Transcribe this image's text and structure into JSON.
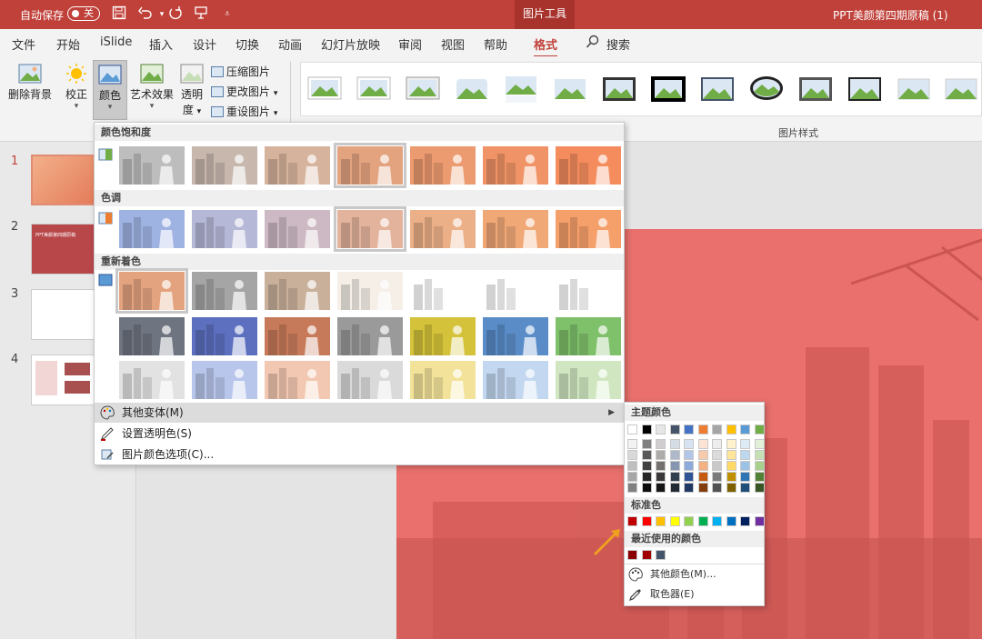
{
  "titlebar": {
    "autosave_label": "自动保存",
    "toggle_label": "关",
    "context_tab": "图片工具",
    "doc_title": "PPT美颜第四期原稿 (1)",
    "quick_icons": [
      "save-icon",
      "undo-icon",
      "redo-icon",
      "present-icon",
      "customize-icon"
    ]
  },
  "tabs": {
    "items": [
      {
        "label": "文件"
      },
      {
        "label": "开始"
      },
      {
        "label": "iSlide"
      },
      {
        "label": "插入"
      },
      {
        "label": "设计"
      },
      {
        "label": "切换"
      },
      {
        "label": "动画"
      },
      {
        "label": "幻灯片放映"
      },
      {
        "label": "审阅"
      },
      {
        "label": "视图"
      },
      {
        "label": "帮助"
      },
      {
        "label": "格式"
      }
    ],
    "active": "格式",
    "search_label": "搜索"
  },
  "ribbon": {
    "remove_bg": "删除背景",
    "correct": "校正",
    "color": "颜色",
    "artistic": "艺术效果",
    "transparency_1": "透明",
    "transparency_2": "度",
    "compress": "压缩图片",
    "change": "更改图片",
    "reset": "重设图片",
    "styles_group": "图片样式"
  },
  "slides": {
    "numbers": [
      "1",
      "2",
      "3",
      "4"
    ],
    "thumb2_text": "PPT美颜第四期原稿"
  },
  "color_menu": {
    "saturation_header": "颜色饱和度",
    "tone_header": "色调",
    "recolor_header": "重新着色",
    "more_variants": "其他变体(M)",
    "set_transparent": "设置透明色(S)",
    "color_options": "图片颜色选项(C)..."
  },
  "color_palette": {
    "theme_header": "主题颜色",
    "standard_header": "标准色",
    "recent_header": "最近使用的颜色",
    "more_colors": "其他颜色(M)...",
    "eyedropper": "取色器(E)",
    "theme_top": [
      "#ffffff",
      "#000000",
      "#e7e6e6",
      "#44546a",
      "#4472c4",
      "#ed7d31",
      "#a5a5a5",
      "#ffc000",
      "#5b9bd5",
      "#70ad47"
    ],
    "theme_shades": [
      [
        "#f2f2f2",
        "#808080",
        "#d0cece",
        "#d6dce4",
        "#d9e2f3",
        "#fbe4d5",
        "#ededed",
        "#fff2cc",
        "#deebf6",
        "#e2efd9"
      ],
      [
        "#d9d9d9",
        "#595959",
        "#aeabab",
        "#adb9ca",
        "#b4c6e7",
        "#f7caac",
        "#dbdbdb",
        "#fee599",
        "#bdd7ee",
        "#c5e0b3"
      ],
      [
        "#bfbfbf",
        "#404040",
        "#757070",
        "#8496b0",
        "#8eaadb",
        "#f4b183",
        "#c9c9c9",
        "#ffd966",
        "#9cc3e5",
        "#a8d08d"
      ],
      [
        "#a6a6a6",
        "#262626",
        "#3a3838",
        "#323f4f",
        "#2f5496",
        "#c55a11",
        "#7b7b7b",
        "#bf8f00",
        "#2e75b5",
        "#538135"
      ],
      [
        "#808080",
        "#0d0d0d",
        "#171616",
        "#222a35",
        "#1f3864",
        "#833c0b",
        "#525252",
        "#7f6000",
        "#1e4e79",
        "#375623"
      ]
    ],
    "standard": [
      "#c00000",
      "#ff0000",
      "#ffc000",
      "#ffff00",
      "#92d050",
      "#00b050",
      "#00b0f0",
      "#0070c0",
      "#002060",
      "#7030a0"
    ],
    "recent": [
      "#8b0000",
      "#a00000",
      "#44546a"
    ]
  }
}
